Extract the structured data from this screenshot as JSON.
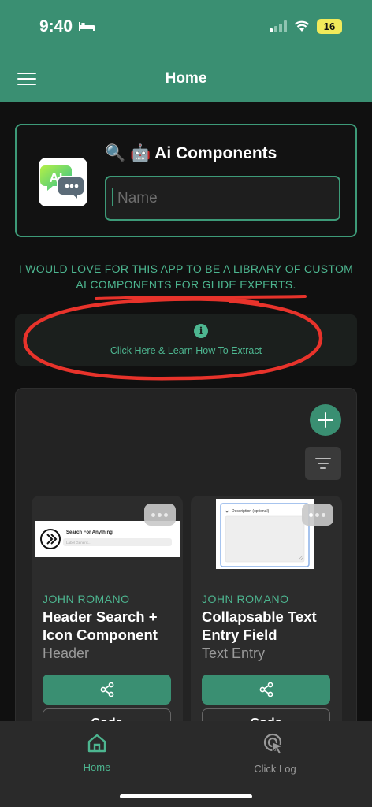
{
  "status_bar": {
    "time": "9:40",
    "battery": "16"
  },
  "header": {
    "title": "Home"
  },
  "hero": {
    "title": "🔍 🤖 Ai Components",
    "name_placeholder": "Name",
    "app_icon_badge": "AI"
  },
  "banner": {
    "text": "I WOULD LOVE FOR THIS APP TO BE A LIBRARY OF CUSTOM AI COMPONENTS FOR GLIDE EXPERTS."
  },
  "info": {
    "icon": "info-icon",
    "label": "Click Here & Learn How To Extract"
  },
  "toolbar": {
    "add_icon": "plus-icon",
    "filter_icon": "filter-icon"
  },
  "cards": [
    {
      "author": "JOHN ROMANO",
      "title": "Header Search + Icon Component",
      "category": "Header",
      "thumb_text": "Search For Anything",
      "thumb_subtext": "Label Generic...",
      "code_label": "Code"
    },
    {
      "author": "JOHN ROMANO",
      "title": "Collapsable Text Entry Field",
      "category": "Text Entry",
      "thumb_text": "Description (optional)",
      "code_label": "Code"
    }
  ],
  "tabs": [
    {
      "label": "Home",
      "icon": "home-icon",
      "active": true
    },
    {
      "label": "Click Log",
      "icon": "cursor-click-icon",
      "active": false
    }
  ],
  "colors": {
    "accent": "#3a8f72",
    "accent_text": "#4db690",
    "background": "#101010",
    "annotation": "#e8332b"
  }
}
